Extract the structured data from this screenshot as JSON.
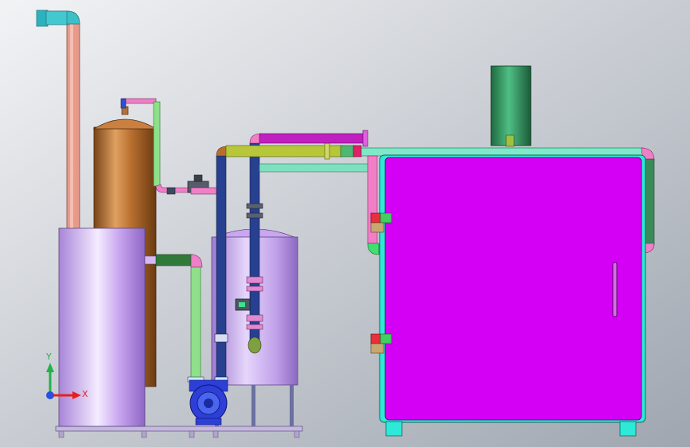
{
  "colors": {
    "background_light": "#f2f3f5",
    "background_dark": "#9fa6b0",
    "cabinet_magenta": "#d400f5",
    "cabinet_frame": "#2ee8d8",
    "tank_lavender": "#c9a6ef",
    "tank_copper": "#b86f2e",
    "pipe_salmon": "#e89a8a",
    "pipe_green": "#8fe08a",
    "pipe_pink": "#f07fc8",
    "pipe_navy": "#27408f",
    "pipe_olive": "#b8c63a",
    "pipe_teal": "#7fe0c0",
    "chimney_green": "#2e8f5a",
    "pump_blue": "#2d3fd6",
    "axis_green": "#22b14c",
    "axis_red": "#e8201c",
    "axis_blue": "#2b4fe0"
  },
  "icons": {
    "pump": "centrifugal-pump-icon",
    "valve": "gate-valve-icon",
    "triad": "coordinate-triad-icon"
  },
  "triad": {
    "x_label": "X",
    "y_label": "Y"
  }
}
